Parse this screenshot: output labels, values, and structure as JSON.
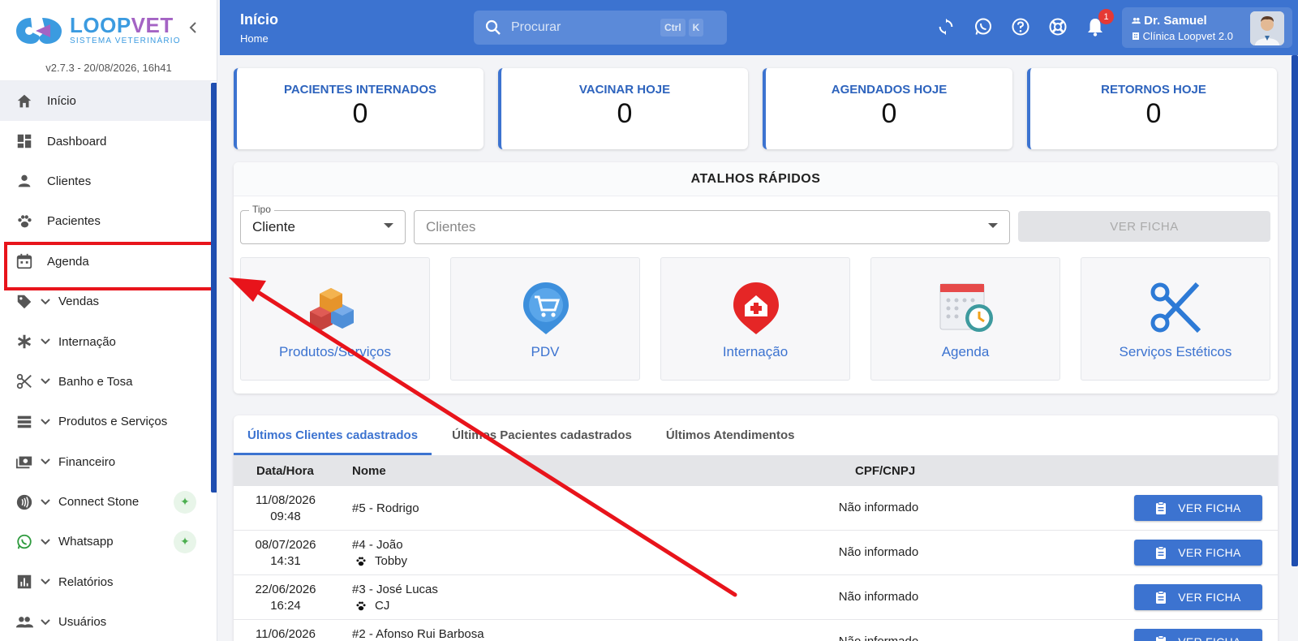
{
  "brand": {
    "name_a": "LOOP",
    "name_b": "VET",
    "subtitle": "SISTEMA VETERINÁRIO",
    "version": "v2.7.3 - 20/08/2026, 16h41"
  },
  "sidebar": {
    "items": [
      {
        "label": "Início",
        "icon": "home-icon"
      },
      {
        "label": "Dashboard",
        "icon": "dashboard-icon"
      },
      {
        "label": "Clientes",
        "icon": "person-icon"
      },
      {
        "label": "Pacientes",
        "icon": "paw-icon"
      },
      {
        "label": "Agenda",
        "icon": "calendar-icon"
      },
      {
        "label": "Vendas",
        "icon": "tag-icon"
      },
      {
        "label": "Internação",
        "icon": "asterisk-icon"
      },
      {
        "label": "Banho e Tosa",
        "icon": "scissors-icon"
      },
      {
        "label": "Produtos e Serviços",
        "icon": "list-icon"
      },
      {
        "label": "Financeiro",
        "icon": "cash-icon"
      },
      {
        "label": "Connect Stone",
        "icon": "contactless-icon"
      },
      {
        "label": "Whatsapp",
        "icon": "whatsapp-icon"
      },
      {
        "label": "Relatórios",
        "icon": "chart-icon"
      },
      {
        "label": "Usuários",
        "icon": "users-icon"
      }
    ]
  },
  "header": {
    "title": "Início",
    "breadcrumb": "Home",
    "search_placeholder": "Procurar",
    "kbd_ctrl": "Ctrl",
    "kbd_k": "K",
    "notification_count": "1",
    "user_name": "Dr. Samuel",
    "clinic": "Clínica Loopvet 2.0"
  },
  "stats": [
    {
      "label": "PACIENTES INTERNADOS",
      "value": "0"
    },
    {
      "label": "VACINAR HOJE",
      "value": "0"
    },
    {
      "label": "AGENDADOS HOJE",
      "value": "0"
    },
    {
      "label": "RETORNOS HOJE",
      "value": "0"
    }
  ],
  "shortcuts": {
    "title": "ATALHOS RÁPIDOS",
    "type_label": "Tipo",
    "type_value": "Cliente",
    "client_placeholder": "Clientes",
    "ver_ficha": "VER FICHA",
    "items": [
      {
        "label": "Produtos/Serviços"
      },
      {
        "label": "PDV"
      },
      {
        "label": "Internação"
      },
      {
        "label": "Agenda"
      },
      {
        "label": "Serviços Estéticos"
      }
    ]
  },
  "recent": {
    "tabs": [
      "Últimos Clientes cadastrados",
      "Últimos Pacientes cadastrados",
      "Últimos Atendimentos"
    ],
    "columns": {
      "date": "Data/Hora",
      "name": "Nome",
      "cpf": "CPF/CNPJ"
    },
    "button": "VER FICHA",
    "rows": [
      {
        "date": "11/08/2026",
        "time": "09:48",
        "name": "#5 - Rodrigo",
        "pet": "",
        "cpf": "Não informado"
      },
      {
        "date": "08/07/2026",
        "time": "14:31",
        "name": "#4 - João",
        "pet": "Tobby",
        "cpf": "Não informado"
      },
      {
        "date": "22/06/2026",
        "time": "16:24",
        "name": "#3 - José Lucas",
        "pet": "CJ",
        "cpf": "Não informado"
      },
      {
        "date": "11/06/2026",
        "time": "",
        "name": "#2 - Afonso Rui Barbosa",
        "pet": "",
        "cpf": "Não informado"
      }
    ]
  },
  "colors": {
    "primary": "#3c73d0",
    "sidebar_accent": "#1f4eb0",
    "highlight": "#e8141b"
  }
}
